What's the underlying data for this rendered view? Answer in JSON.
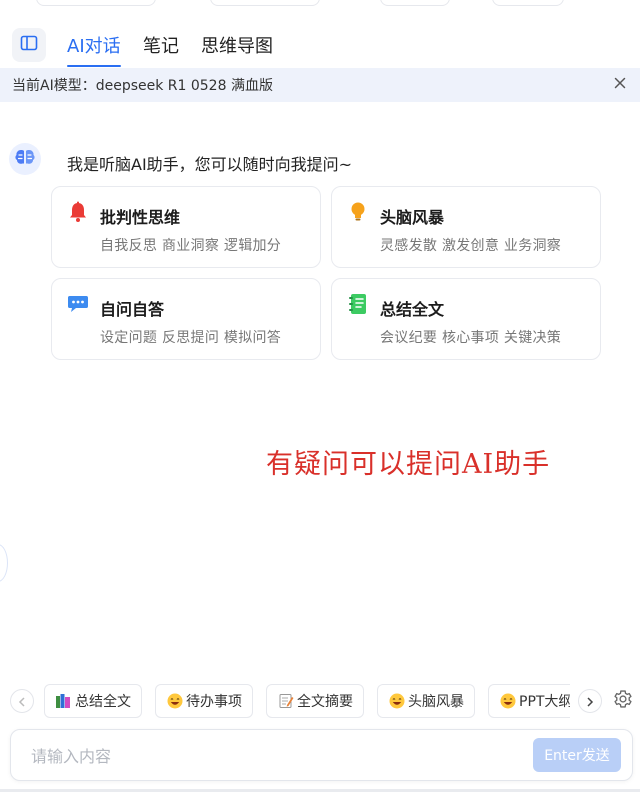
{
  "tabs": [
    {
      "label": "AI对话",
      "active": true
    },
    {
      "label": "笔记",
      "active": false
    },
    {
      "label": "思维导图",
      "active": false
    }
  ],
  "banner": {
    "model_text": "当前AI模型：deepseek R1 0528 满血版"
  },
  "chat": {
    "greeting": "我是听脑AI助手，您可以随时向我提问~"
  },
  "cards": [
    {
      "title": "批判性思维",
      "subtitle": "自我反思 商业洞察 逻辑加分",
      "icon": "bell-icon",
      "color": "#ea3b36"
    },
    {
      "title": "头脑风暴",
      "subtitle": "灵感发散 激发创意 业务洞察",
      "icon": "lightbulb-icon",
      "color": "#f6a21b"
    },
    {
      "title": "自问自答",
      "subtitle": "设定问题 反思提问 模拟问答",
      "icon": "chat-bubble-icon",
      "color": "#3d8bf0"
    },
    {
      "title": "总结全文",
      "subtitle": "会议纪要 核心事项 关键决策",
      "icon": "notebook-icon",
      "color": "#3ccb62"
    }
  ],
  "annotation": "有疑问可以提问AI助手",
  "quick_actions": [
    {
      "label": "总结全文",
      "icon": "books-icon"
    },
    {
      "label": "待办事项",
      "icon": "smile-emoji-icon"
    },
    {
      "label": "全文摘要",
      "icon": "memo-icon"
    },
    {
      "label": "头脑风暴",
      "icon": "smile-emoji-icon"
    },
    {
      "label": "PPT大纲",
      "icon": "smile-emoji-icon"
    }
  ],
  "composer": {
    "placeholder": "请输入内容",
    "send_label": "Enter发送"
  },
  "colors": {
    "accent": "#2a6ef2",
    "banner_bg": "#eef2fb",
    "annotation": "#d9302a",
    "send_disabled": "#b9cff7"
  }
}
